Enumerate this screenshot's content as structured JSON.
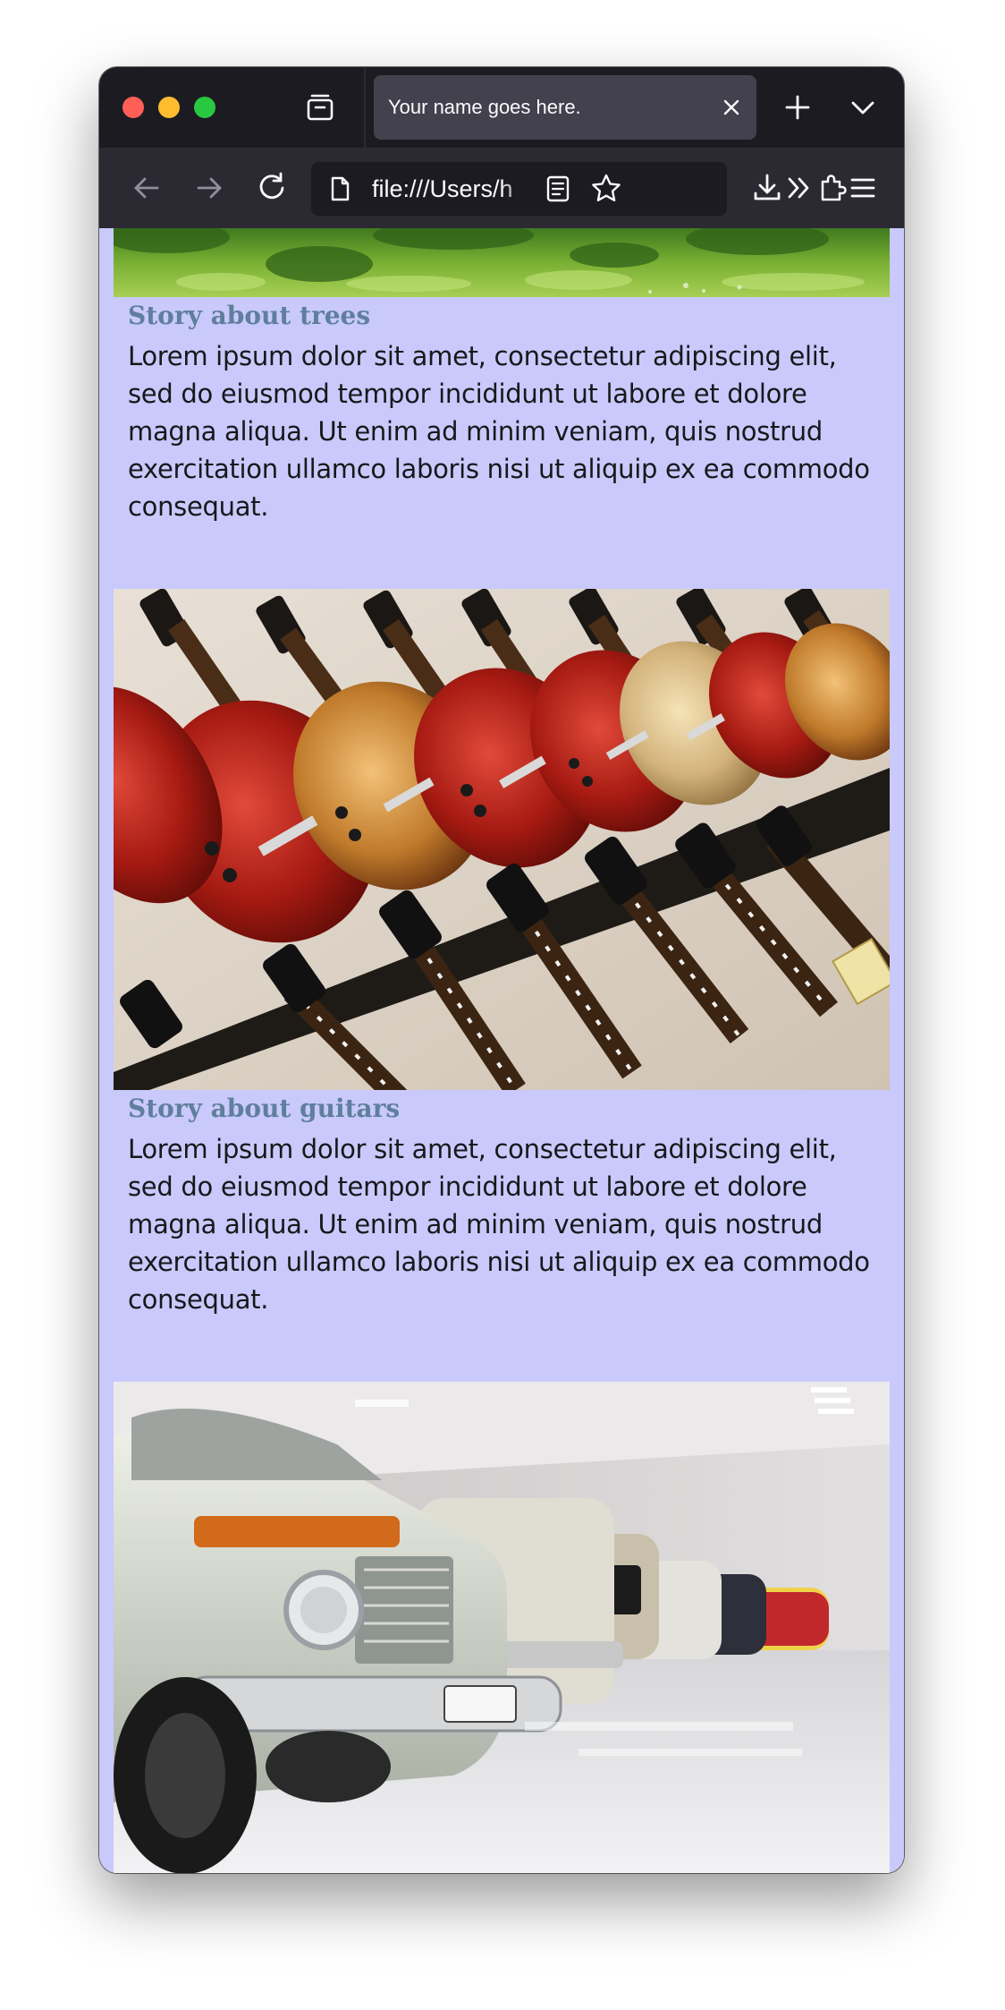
{
  "browser": {
    "tab_title": "Your name goes here.",
    "url": "file:///Users/h"
  },
  "stories": [
    {
      "title": "Story about trees",
      "image_subject": "trees",
      "body": "Lorem ipsum dolor sit amet, consectetur adipiscing elit, sed do eiusmod tempor incididunt ut labore et dolore magna aliqua. Ut enim ad minim veniam, quis nostrud exercitation ullamco laboris nisi ut aliquip ex ea commodo consequat."
    },
    {
      "title": "Story about guitars",
      "image_subject": "guitars",
      "body": "Lorem ipsum dolor sit amet, consectetur adipiscing elit, sed do eiusmod tempor incididunt ut labore et dolore magna aliqua. Ut enim ad minim veniam, quis nostrud exercitation ullamco laboris nisi ut aliquip ex ea commodo consequat."
    },
    {
      "image_subject": "cars"
    }
  ],
  "colors": {
    "page_background": "#c9c9fc",
    "story_title": "#5f7f9d",
    "body_text": "#18181b",
    "browser_chrome": "#1c1b22",
    "toolbar": "#2b2a33",
    "active_tab": "#42414d"
  }
}
